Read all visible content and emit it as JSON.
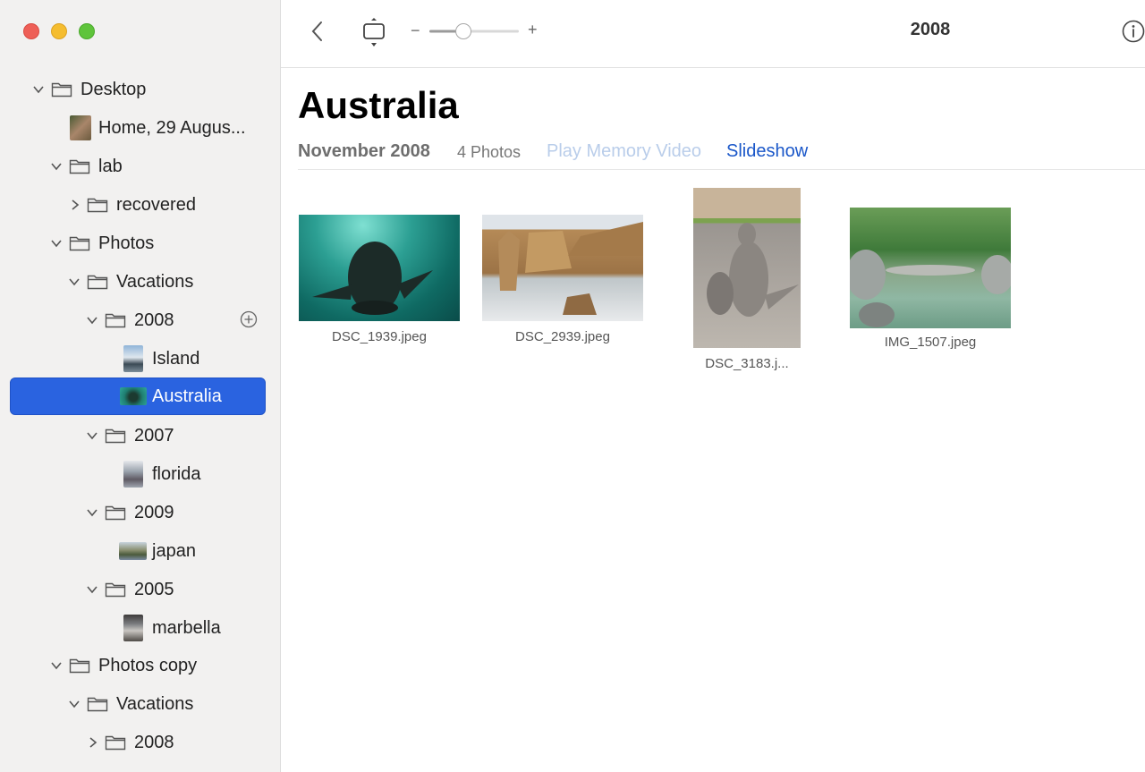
{
  "sidebar": {
    "items": [
      {
        "label": "Desktop",
        "kind": "folder",
        "expanded": true
      },
      {
        "label": "Home, 29 Augus...",
        "kind": "photo"
      },
      {
        "label": "lab",
        "kind": "folder",
        "expanded": true
      },
      {
        "label": "recovered",
        "kind": "folder",
        "expanded": false
      },
      {
        "label": "Photos",
        "kind": "folder",
        "expanded": true
      },
      {
        "label": "Vacations",
        "kind": "folder",
        "expanded": true
      },
      {
        "label": "2008",
        "kind": "folder",
        "expanded": true
      },
      {
        "label": "Island",
        "kind": "album"
      },
      {
        "label": "Australia",
        "kind": "album",
        "selected": true
      },
      {
        "label": "2007",
        "kind": "folder",
        "expanded": true
      },
      {
        "label": "florida",
        "kind": "album"
      },
      {
        "label": "2009",
        "kind": "folder",
        "expanded": true
      },
      {
        "label": "japan",
        "kind": "album"
      },
      {
        "label": "2005",
        "kind": "folder",
        "expanded": true
      },
      {
        "label": "marbella",
        "kind": "album"
      },
      {
        "label": "Photos copy",
        "kind": "folder",
        "expanded": true
      },
      {
        "label": "Vacations",
        "kind": "folder",
        "expanded": true
      },
      {
        "label": "2008",
        "kind": "folder",
        "expanded": false
      }
    ]
  },
  "toolbar": {
    "title": "2008",
    "zoom_level": 0.33
  },
  "album": {
    "title": "Australia",
    "date": "November 2008",
    "count": "4 Photos",
    "memory_video": "Play Memory Video",
    "slideshow": "Slideshow"
  },
  "photos": [
    {
      "caption": "DSC_1939.jpeg"
    },
    {
      "caption": "DSC_2939.jpeg"
    },
    {
      "caption": "DSC_3183.j..."
    },
    {
      "caption": "IMG_1507.jpeg"
    }
  ],
  "colors": {
    "accent": "#2a63e0",
    "link": "#1a57c9",
    "link_disabled": "#b9cdea"
  }
}
